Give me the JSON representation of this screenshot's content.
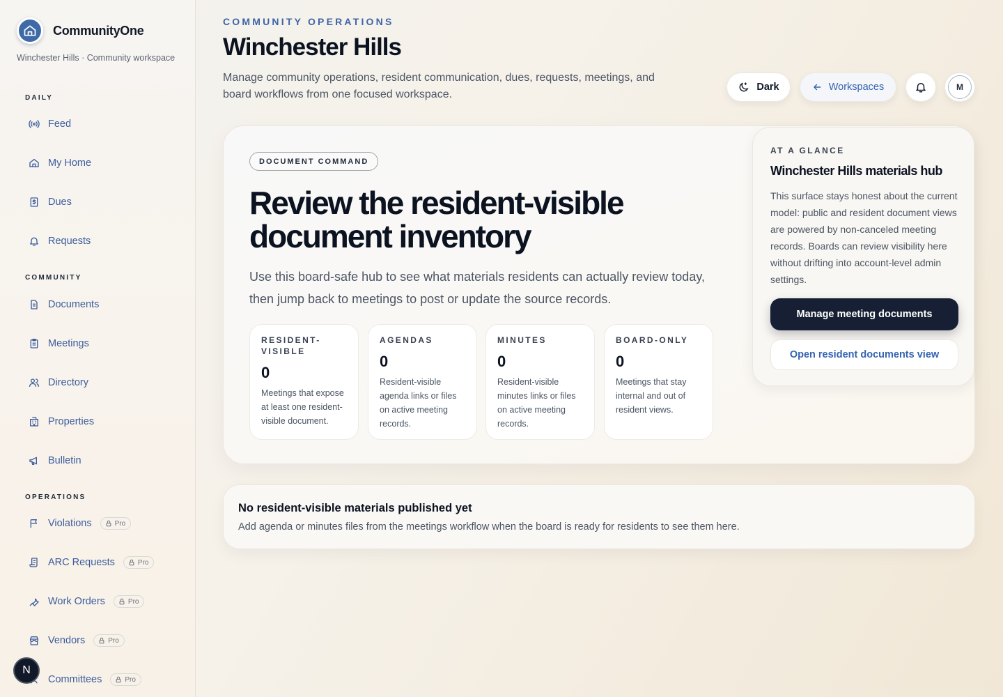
{
  "brand": {
    "name": "CommunityOne",
    "subtitle": "Winchester Hills · Community workspace"
  },
  "sidebar": {
    "sections": [
      {
        "label": "DAILY",
        "items": [
          {
            "label": "Feed",
            "icon": "broadcast-icon"
          },
          {
            "label": "My Home",
            "icon": "home-icon"
          },
          {
            "label": "Dues",
            "icon": "dollar-receipt-icon"
          },
          {
            "label": "Requests",
            "icon": "bell-icon"
          }
        ]
      },
      {
        "label": "COMMUNITY",
        "items": [
          {
            "label": "Documents",
            "icon": "document-icon"
          },
          {
            "label": "Meetings",
            "icon": "clipboard-icon"
          },
          {
            "label": "Directory",
            "icon": "users-icon"
          },
          {
            "label": "Properties",
            "icon": "building-icon"
          },
          {
            "label": "Bulletin",
            "icon": "megaphone-icon"
          }
        ]
      },
      {
        "label": "OPERATIONS",
        "items": [
          {
            "label": "Violations",
            "icon": "flag-icon",
            "badge": "Pro"
          },
          {
            "label": "ARC Requests",
            "icon": "scroll-icon",
            "badge": "Pro"
          },
          {
            "label": "Work Orders",
            "icon": "wrench-icon",
            "badge": "Pro"
          },
          {
            "label": "Vendors",
            "icon": "store-icon",
            "badge": "Pro"
          },
          {
            "label": "Committees",
            "icon": "group-icon",
            "badge": "Pro"
          }
        ]
      }
    ],
    "floating_badge": "N"
  },
  "header": {
    "eyebrow": "COMMUNITY OPERATIONS",
    "title": "Winchester Hills",
    "description": "Manage community operations, resident communication, dues, requests, meetings, and board workflows from one focused workspace.",
    "theme_button": "Dark",
    "workspaces_button": "Workspaces",
    "avatar_initial": "M"
  },
  "hero": {
    "pill": "DOCUMENT COMMAND",
    "title": "Review the resident-visible document inventory",
    "description": "Use this board-safe hub to see what materials residents can actually review today, then jump back to meetings to post or update the source records.",
    "stats": [
      {
        "label": "RESIDENT-VISIBLE",
        "value": "0",
        "desc": "Meetings that expose at least one resident-visible document."
      },
      {
        "label": "AGENDAS",
        "value": "0",
        "desc": "Resident-visible agenda links or files on active meeting records."
      },
      {
        "label": "MINUTES",
        "value": "0",
        "desc": "Resident-visible minutes links or files on active meeting records."
      },
      {
        "label": "BOARD-ONLY",
        "value": "0",
        "desc": "Meetings that stay internal and out of resident views."
      }
    ]
  },
  "glance": {
    "eyebrow": "AT A GLANCE",
    "title": "Winchester Hills materials hub",
    "text": "This surface stays honest about the current model: public and resident document views are powered by non-canceled meeting records. Boards can review visibility here without drifting into account-level admin settings.",
    "primary_button": "Manage meeting documents",
    "secondary_button": "Open resident documents view"
  },
  "notice": {
    "title": "No resident-visible materials published yet",
    "text": "Add agenda or minutes files from the meetings workflow when the board is ready for residents to see them here."
  },
  "colors": {
    "accent": "#3f65a6",
    "link": "#3563b0",
    "dark_button": "#161f33"
  }
}
